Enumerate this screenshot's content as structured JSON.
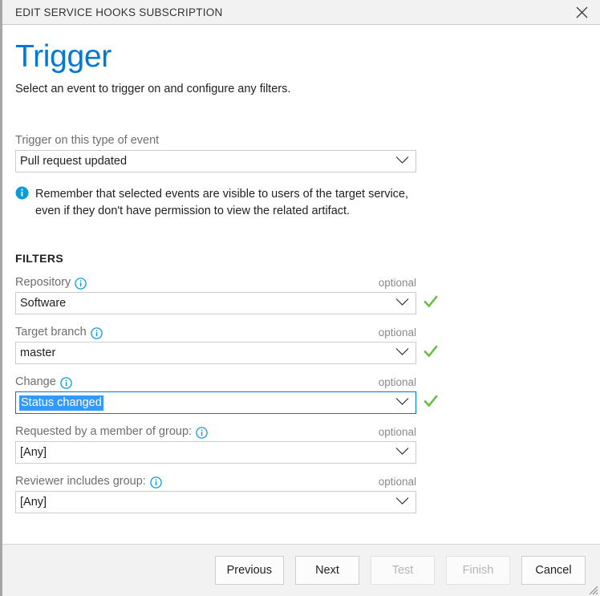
{
  "window": {
    "title": "EDIT SERVICE HOOKS SUBSCRIPTION",
    "close_icon": "close-icon",
    "resize_grip_icon": "resize-grip-icon"
  },
  "page": {
    "heading": "Trigger",
    "subtitle": "Select an event to trigger on and configure any filters.",
    "heading_color": "#0078d7"
  },
  "event": {
    "label": "Trigger on this type of event",
    "value": "Pull request updated",
    "chevron_icon": "chevron-down-icon"
  },
  "notice": {
    "icon": "info-filled-icon",
    "text": "Remember that selected events are visible to users of the target service, even if they don't have permission to view the related artifact."
  },
  "filters": {
    "heading": "FILTERS",
    "optional_tag": "optional",
    "info_icon": "info-outline-icon",
    "valid_icon": "green-check-icon",
    "fields": [
      {
        "label": "Repository",
        "has_info_icon": true,
        "optional": "optional",
        "value": "Software",
        "valid": true,
        "focused": false,
        "selected": false
      },
      {
        "label": "Target branch",
        "has_info_icon": true,
        "optional": "optional",
        "value": "master",
        "valid": true,
        "focused": false,
        "selected": false
      },
      {
        "label": "Change",
        "has_info_icon": true,
        "optional": "optional",
        "value": "Status changed",
        "valid": true,
        "focused": true,
        "selected": true
      },
      {
        "label": "Requested by a member of group:",
        "has_info_icon": true,
        "optional": "optional",
        "value": "[Any]",
        "valid": false,
        "focused": false,
        "selected": false
      },
      {
        "label": "Reviewer includes group:",
        "has_info_icon": true,
        "optional": "optional",
        "value": "[Any]",
        "valid": false,
        "focused": false,
        "selected": false
      }
    ]
  },
  "footer": {
    "buttons": [
      {
        "label": "Previous",
        "disabled": false
      },
      {
        "label": "Next",
        "disabled": false
      },
      {
        "label": "Test",
        "disabled": true
      },
      {
        "label": "Finish",
        "disabled": true
      },
      {
        "label": "Cancel",
        "disabled": false
      }
    ]
  },
  "colors": {
    "accent": "#0078d7",
    "selection": "#3399ff",
    "success": "#70c040",
    "chrome": "#f2f2f2"
  }
}
